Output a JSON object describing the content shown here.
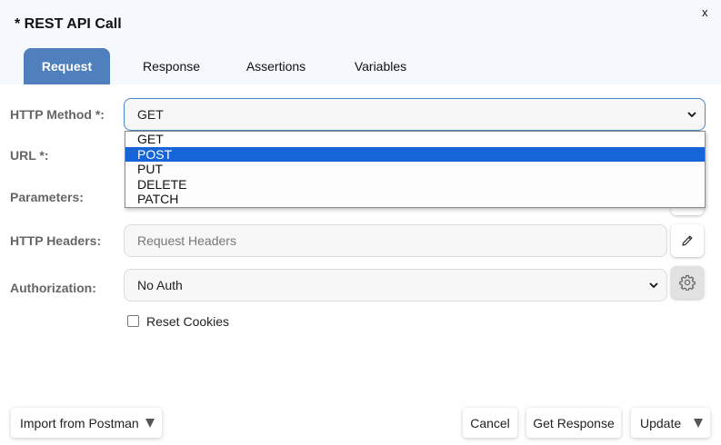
{
  "dialog": {
    "title": "* REST API Call",
    "close_label": "x"
  },
  "tabs": [
    {
      "label": "Request",
      "active": true
    },
    {
      "label": "Response",
      "active": false
    },
    {
      "label": "Assertions",
      "active": false
    },
    {
      "label": "Variables",
      "active": false
    }
  ],
  "form": {
    "http_method": {
      "label": "HTTP Method *:",
      "value": "GET",
      "options": [
        "GET",
        "POST",
        "PUT",
        "DELETE",
        "PATCH"
      ],
      "highlighted_option": "POST"
    },
    "url": {
      "label": "URL *:"
    },
    "parameters": {
      "label": "Parameters:"
    },
    "http_headers": {
      "label": "HTTP Headers:",
      "placeholder": "Request Headers"
    },
    "authorization": {
      "label": "Authorization:",
      "value": "No Auth"
    },
    "reset_cookies": {
      "label": "Reset Cookies",
      "checked": false
    }
  },
  "footer": {
    "import_label": "Import from Postman",
    "cancel_label": "Cancel",
    "get_response_label": "Get Response",
    "update_label": "Update"
  },
  "icons": {
    "edit": "pencil-icon",
    "settings": "gear-icon",
    "dropdown": "chevron-down-icon",
    "split": "caret-down-icon"
  },
  "colors": {
    "accent": "#4f7fbd",
    "selection": "#1565d8",
    "header_bg": "#f5f8fc"
  }
}
